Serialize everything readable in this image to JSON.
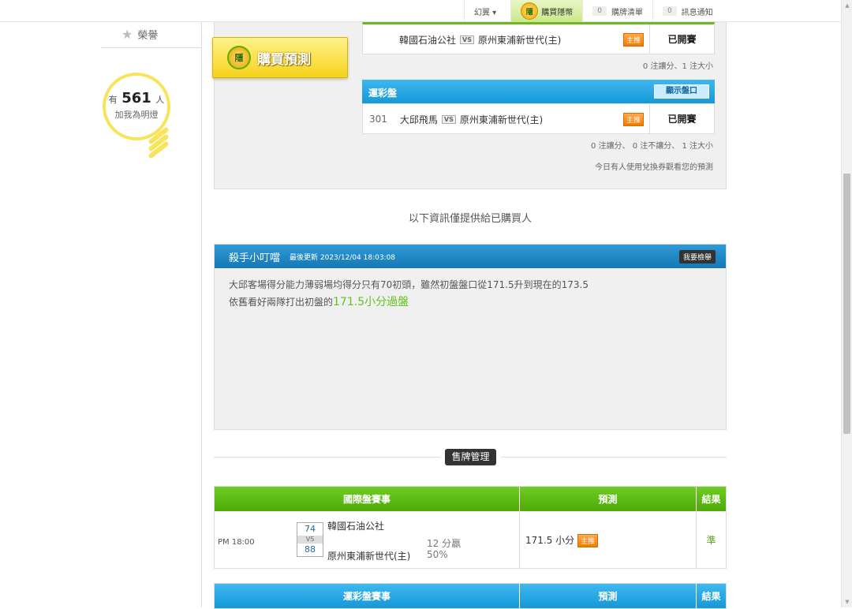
{
  "topnav": {
    "user": "幻翼 ▾",
    "buy_label": "購買隱幣",
    "buy_logo": "隱",
    "cart_count": "0",
    "cart_label": "購牌清單",
    "msg_count": "0",
    "msg_label": "訊息通知"
  },
  "sidebar": {
    "rank_label": "榮譽",
    "bulb_prefix": "有",
    "bulb_count": "561",
    "bulb_suffix": "人",
    "bulb_line2": "加我為明燈"
  },
  "panel": {
    "buy_button_label": "購買預測",
    "buy_logo": "隱",
    "intl_game": {
      "home": "韓國石油公社",
      "vs": "VS",
      "away": "原州東浦新世代(主)",
      "tag": "主推",
      "status": "已開賽"
    },
    "intl_note": "0 注讓分、1 注大小",
    "lottery_title": "運彩盤",
    "show_button": "顯示盤口",
    "lottery_game": {
      "number": "301",
      "home": "大邱飛馬",
      "vs": "VS",
      "away": "原州東浦新世代(主)",
      "tag": "主推",
      "status": "已開賽"
    },
    "lottery_note": "0 注讓分、 0 注不讓分、 1 注大小",
    "voucher_note": "今日有人使用兌換券觀看您的預測"
  },
  "info_text": "以下資訊僅提供給已購買人",
  "prediction": {
    "author": "殺手小叮噹",
    "updated": "最後更新 2023/12/04 18:03:08",
    "report_button": "我要檢舉",
    "line1": "大邱客場得分能力薄弱場均得分只有70初頭，雖然初盤盤口從171.5升到現在的173.5",
    "line2_prefix": "依舊看好兩隊打出初盤的",
    "line2_highlight": "171.5小分過盤"
  },
  "sale_button": "售牌管理",
  "intl_table": {
    "headers": [
      "國際盤賽事",
      "預測",
      "結果"
    ],
    "row": {
      "time": "PM 18:00",
      "score_home": "74",
      "vs": "VS",
      "score_away": "88",
      "team_home": "韓國石油公社",
      "team_away": "原州東浦新世代(主)",
      "spread": "12 分贏",
      "percent": "50%",
      "prediction": "171.5 小分",
      "tag": "主推",
      "result": "準"
    }
  },
  "lottery_table": {
    "headers": [
      "運彩盤賽事",
      "預測",
      "結果"
    ]
  },
  "colors": {
    "green_header": "#5ab812",
    "blue_header": "#1ea5e3",
    "highlight": "#5ec31a",
    "tag": "#f08a1c"
  }
}
